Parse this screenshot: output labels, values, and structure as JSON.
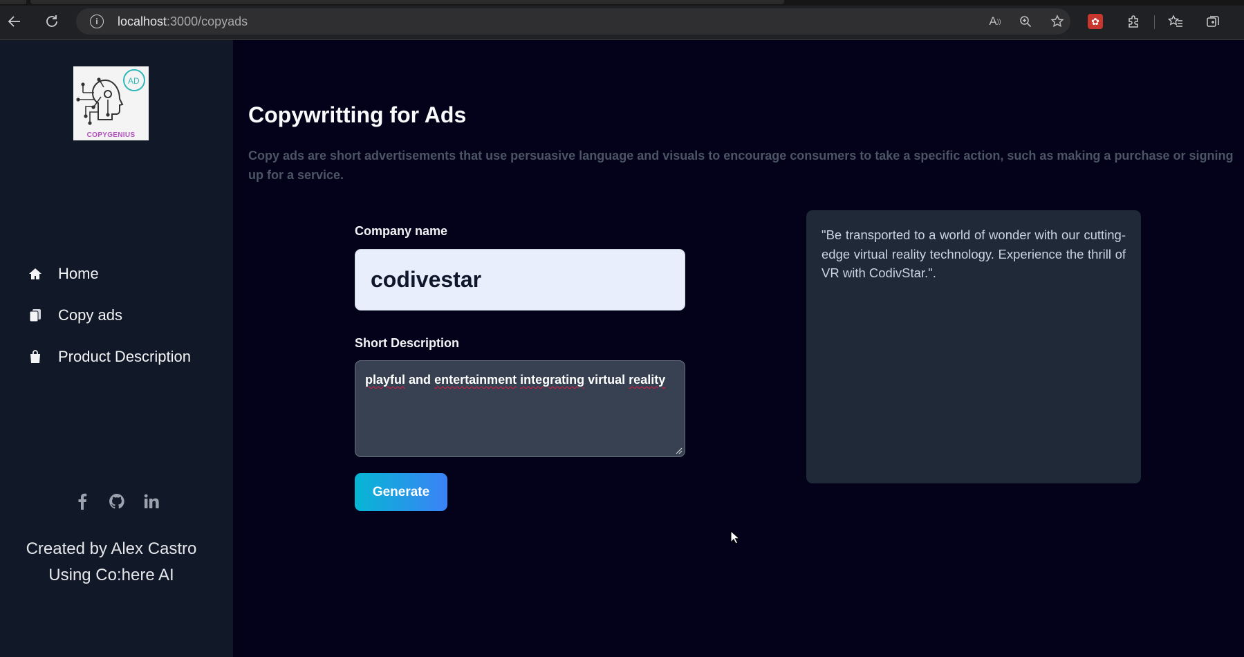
{
  "browser": {
    "url_host": "localhost",
    "url_path": ":3000/copyads"
  },
  "sidebar": {
    "logo_text": "COPYGENIUS",
    "logo_badge": "AD",
    "items": [
      {
        "label": "Home",
        "icon": "home-icon"
      },
      {
        "label": "Copy ads",
        "icon": "copy-icon"
      },
      {
        "label": "Product Description",
        "icon": "shopping-bag-icon"
      }
    ],
    "socials": [
      "facebook-icon",
      "github-icon",
      "linkedin-icon"
    ],
    "credit_line1": "Created by Alex Castro",
    "credit_line2": "Using Co:here AI"
  },
  "main": {
    "title": "Copywritting for Ads",
    "description": "Copy ads are short advertisements that use persuasive language and visuals to encourage consumers to take a specific action, such as making a purchase or signing up for a service.",
    "company_label": "Company name",
    "company_value": "codivestar",
    "short_desc_label": "Short Description",
    "short_desc_words": [
      "playful",
      "and",
      "entertainment",
      "integrating",
      "virtual",
      "reality"
    ],
    "generate_label": "Generate",
    "result_text": "\"Be transported to a world of wonder with our cutting-edge virtual reality technology. Experience the thrill of VR with CodivStar.\"."
  },
  "colors": {
    "page_bg": "#03021a",
    "sidebar_bg": "#111827",
    "accent_from": "#06b6d4",
    "accent_to": "#3b82f6"
  }
}
